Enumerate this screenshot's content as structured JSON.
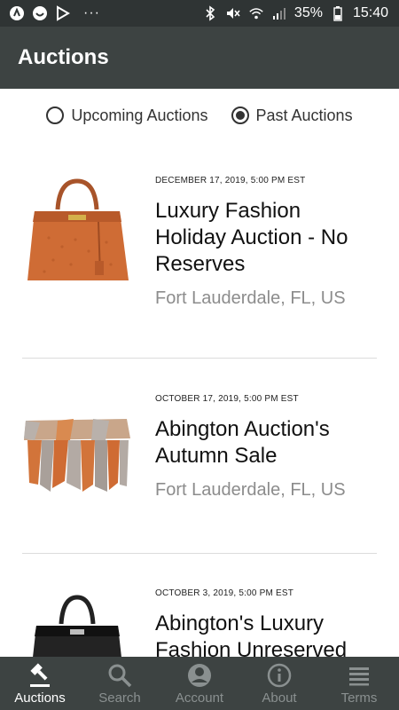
{
  "status_bar": {
    "left_icons": [
      "app-a-icon",
      "face-icon",
      "play-store-icon"
    ],
    "more": "···",
    "battery": "35%",
    "time": "15:40"
  },
  "app_bar": {
    "title": "Auctions"
  },
  "filters": {
    "options": [
      {
        "label": "Upcoming Auctions",
        "selected": false
      },
      {
        "label": "Past Auctions",
        "selected": true
      }
    ]
  },
  "auctions": [
    {
      "date": "DECEMBER 17, 2019, 5:00 PM EST",
      "title": "Luxury Fashion Holiday Auction - No Reserves",
      "location": "Fort Lauderdale, FL, US",
      "image": "orange-ostrich-handbag"
    },
    {
      "date": "OCTOBER 17, 2019, 5:00 PM EST",
      "title": "Abington Auction's Autumn Sale",
      "location": "Fort Lauderdale, FL, US",
      "image": "faceted-wood-bench"
    },
    {
      "date": "OCTOBER 3, 2019, 5:00 PM EST",
      "title": "Abington's Luxury Fashion Unreserved",
      "location": "",
      "image": "black-leather-handbag"
    }
  ],
  "bottom_nav": {
    "items": [
      {
        "label": "Auctions",
        "icon": "gavel-icon",
        "active": true
      },
      {
        "label": "Search",
        "icon": "search-icon",
        "active": false
      },
      {
        "label": "Account",
        "icon": "account-icon",
        "active": false
      },
      {
        "label": "About",
        "icon": "info-icon",
        "active": false
      },
      {
        "label": "Terms",
        "icon": "list-icon",
        "active": false
      }
    ]
  },
  "colors": {
    "app_bar": "#3d4342",
    "status_bar": "#2f3434",
    "nav_inactive": "#8a9090",
    "nav_active": "#ffffff",
    "location_text": "#8c8c8c"
  }
}
